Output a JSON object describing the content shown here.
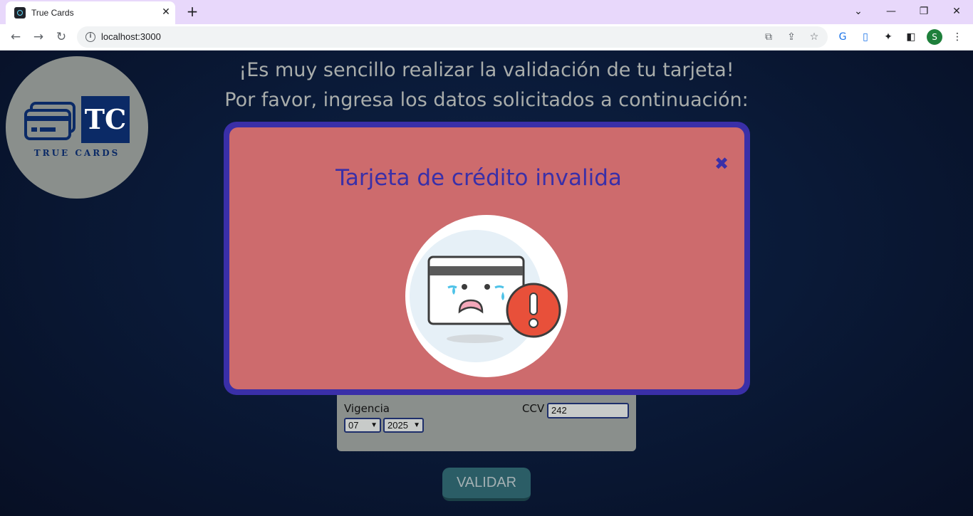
{
  "browser": {
    "tab_title": "True Cards",
    "tab_close": "✕",
    "new_tab": "+",
    "url": "localhost:3000",
    "profile_initial": "S",
    "window_controls": {
      "dropdown": "⌄",
      "minimize": "—",
      "restore": "❐",
      "close": "✕"
    }
  },
  "logo": {
    "monogram": "TC",
    "name": "TRUE CARDS"
  },
  "headline": {
    "line1": "¡Es muy sencillo realizar la validación de tu tarjeta!",
    "line2": "Por favor, ingresa los datos solicitados a continuación:"
  },
  "form": {
    "expiry_label": "Vigencia",
    "month_value": "07",
    "year_value": "2025",
    "ccv_label": "CCV",
    "ccv_value": "242"
  },
  "validate_button": "VALIDAR",
  "modal": {
    "title": "Tarjeta de crédito invalida",
    "close_symbol": "✖"
  },
  "colors": {
    "modal_border": "#3a2fa8",
    "modal_background": "#cd6b6d",
    "page_background": "#0b1632",
    "form_background": "#8a8f8c",
    "button_background": "#2b5d66"
  }
}
